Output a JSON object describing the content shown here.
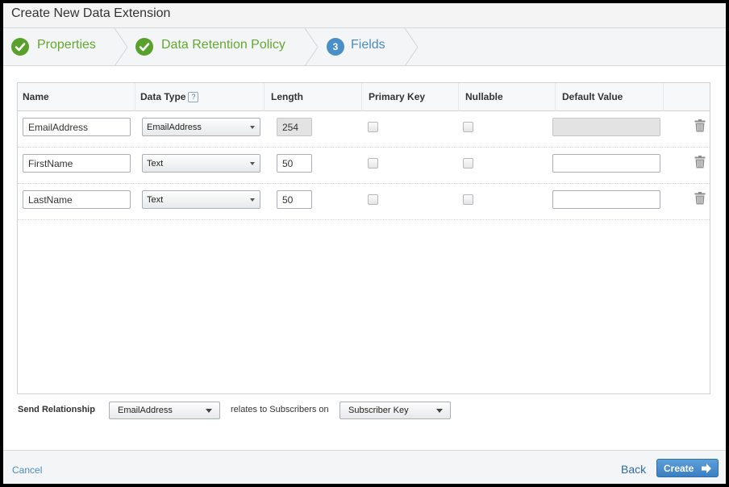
{
  "dialog": {
    "title": "Create New Data Extension"
  },
  "steps": [
    {
      "label": "Properties",
      "state": "done"
    },
    {
      "label": "Data Retention Policy",
      "state": "done"
    },
    {
      "number": "3",
      "label": "Fields",
      "state": "active"
    }
  ],
  "columns": {
    "name": "Name",
    "data_type": "Data Type",
    "data_type_help": "?",
    "length": "Length",
    "primary_key": "Primary Key",
    "nullable": "Nullable",
    "default_value": "Default Value"
  },
  "rows": [
    {
      "name": "EmailAddress",
      "data_type": "EmailAddress",
      "length": "254",
      "length_disabled": true,
      "primary_key": false,
      "nullable": false,
      "default_value": "",
      "default_disabled": true
    },
    {
      "name": "FirstName",
      "data_type": "Text",
      "length": "50",
      "length_disabled": false,
      "primary_key": false,
      "nullable": false,
      "default_value": "",
      "default_disabled": false
    },
    {
      "name": "LastName",
      "data_type": "Text",
      "length": "50",
      "length_disabled": false,
      "primary_key": false,
      "nullable": false,
      "default_value": "",
      "default_disabled": false
    }
  ],
  "send_relationship": {
    "label": "Send Relationship",
    "field": "EmailAddress",
    "relates_text": "relates to Subscribers on",
    "subscriber_field": "Subscriber Key"
  },
  "footer": {
    "cancel": "Cancel",
    "back": "Back",
    "create": "Create"
  },
  "icons": {
    "step_done": "check-circle-icon",
    "delete": "trash-icon",
    "create": "arrow-right-icon"
  },
  "colors": {
    "done_green": "#64a82f",
    "active_blue": "#4c8cc4",
    "primary_button": "#3a7fc2"
  }
}
